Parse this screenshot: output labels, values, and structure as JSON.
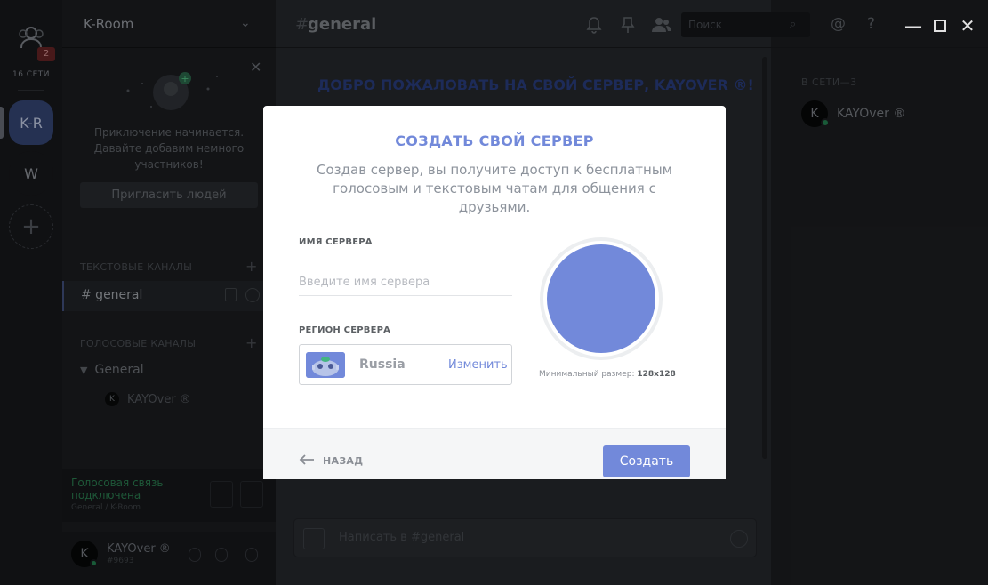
{
  "rail": {
    "online_count": "16 СЕТИ",
    "notification_badge": "2",
    "servers": [
      {
        "abbr": "K-R"
      },
      {
        "abbr": "W"
      }
    ],
    "add_server_symbol": "+"
  },
  "sidebar": {
    "server_name": "K-Room",
    "invite": {
      "text": "Приключение начинается. Давайте добавим немного участников!",
      "button": "Пригласить людей"
    },
    "text_category": "ТЕКСТОВЫЕ КАНАЛЫ",
    "text_channel": "# general",
    "voice_category": "ГОЛОСОВЫЕ КАНАЛЫ",
    "voice_channel": "General",
    "voice_user": "KAYOver ®",
    "voice_user_initial": "K",
    "voice_status": "Голосовая связь подключена",
    "voice_location": "General / K-Room",
    "user": {
      "name": "KAYOver ®",
      "tag": "#9693",
      "initial": "K"
    }
  },
  "main": {
    "channel_hash": "#",
    "channel_name": "general",
    "welcome": "ДОБРО ПОЖАЛОВАТЬ НА СВОЙ СЕРВЕР, KAYOVER ®!",
    "message_placeholder": "Написать в #general"
  },
  "toolbar": {
    "search_placeholder": "Поиск",
    "icons": [
      "bell-icon",
      "pin-icon",
      "members-icon",
      "at-icon",
      "help-icon"
    ]
  },
  "members": {
    "online_label": "В СЕТИ—3",
    "list": [
      {
        "name": "KAYOver ®",
        "initial": "K"
      }
    ]
  },
  "window_controls": {
    "minimize": "—",
    "maximize": "☐",
    "close": "✕"
  },
  "modal": {
    "title": "СОЗДАТЬ СВОЙ СЕРВЕР",
    "subtitle": "Создав сервер, вы получите доступ к бесплатным голосовым и текстовым чатам для общения с друзьями.",
    "server_name_label": "ИМЯ СЕРВЕРА",
    "server_name_value": "",
    "server_name_placeholder": "Введите имя сервера",
    "region_label": "РЕГИОН СЕРВЕРА",
    "region_name": "Russia",
    "region_change": "Изменить",
    "min_size_label": "Минимальный размер:",
    "min_size_value": "128x128",
    "back": "НАЗАД",
    "create": "Создать"
  },
  "colors": {
    "accent": "#7289da",
    "online": "#43b581",
    "background": "#1e2124"
  }
}
